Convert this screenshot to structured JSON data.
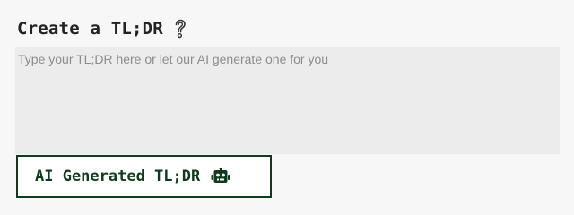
{
  "section": {
    "title": "Create a TL;DR",
    "help_icon": "question-mark-icon"
  },
  "tldr_input": {
    "value": "",
    "placeholder": "Type your TL;DR here or let our AI generate one for you"
  },
  "ai_button": {
    "label": "AI Generated TL;DR",
    "icon": "robot-icon"
  },
  "colors": {
    "accent": "#0f3b1d",
    "background": "#f7f7f7",
    "input_background": "#ececec",
    "placeholder": "#8c8c8c"
  }
}
